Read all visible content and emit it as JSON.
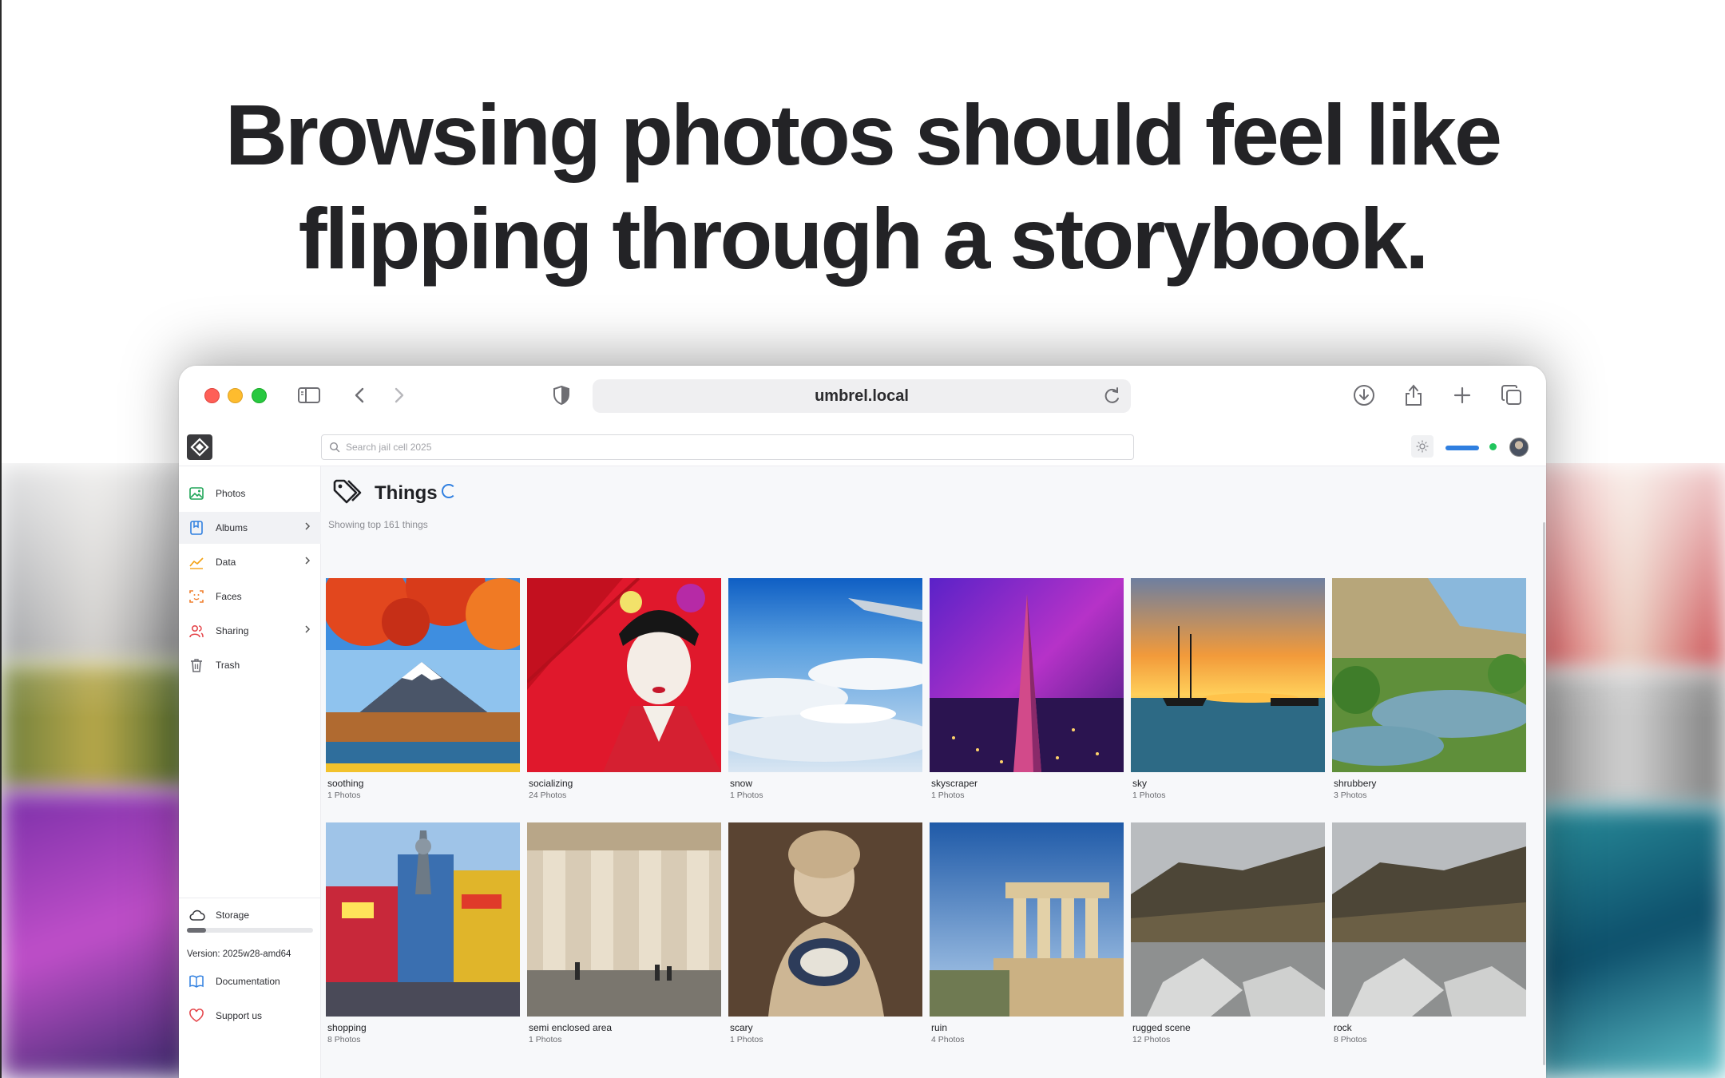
{
  "headline": {
    "line1": "Browsing photos should feel like",
    "line2": "flipping through a storybook."
  },
  "browser": {
    "url": "umbrel.local",
    "icons": [
      "sidebar-toggle-icon",
      "back-icon",
      "forward-icon",
      "shield-icon",
      "reload-icon",
      "download-icon",
      "share-icon",
      "new-tab-icon",
      "tab-overview-icon"
    ]
  },
  "app": {
    "search_placeholder": "Search jail cell 2025",
    "sidebar": {
      "items": [
        {
          "label": "Photos",
          "icon": "image-icon",
          "color": "#22a65a"
        },
        {
          "label": "Albums",
          "icon": "album-icon",
          "color": "#2f7fe0"
        },
        {
          "label": "Data",
          "icon": "chart-icon",
          "color": "#f4a316"
        },
        {
          "label": "Faces",
          "icon": "face-scan-icon",
          "color": "#f08030"
        },
        {
          "label": "Sharing",
          "icon": "users-icon",
          "color": "#e5484d"
        },
        {
          "label": "Trash",
          "icon": "trash-icon",
          "color": "#6b6c72"
        }
      ],
      "storage_label": "Storage",
      "storage_used_fraction": 0.15,
      "version": "Version: 2025w28-amd64",
      "documentation_label": "Documentation",
      "support_label": "Support us"
    },
    "page": {
      "title": "Things",
      "subtitle": "Showing top 161 things"
    },
    "things": [
      {
        "name": "soothing",
        "count": "1 Photos"
      },
      {
        "name": "socializing",
        "count": "24 Photos"
      },
      {
        "name": "snow",
        "count": "1 Photos"
      },
      {
        "name": "skyscraper",
        "count": "1 Photos"
      },
      {
        "name": "sky",
        "count": "1 Photos"
      },
      {
        "name": "shrubbery",
        "count": "3 Photos"
      },
      {
        "name": "shopping",
        "count": "8 Photos"
      },
      {
        "name": "semi enclosed area",
        "count": "1 Photos"
      },
      {
        "name": "scary",
        "count": "1 Photos"
      },
      {
        "name": "ruin",
        "count": "4 Photos"
      },
      {
        "name": "rugged scene",
        "count": "12 Photos"
      },
      {
        "name": "rock",
        "count": "8 Photos"
      }
    ]
  },
  "colors": {
    "accent": "#2f7fe0",
    "status_online": "#21c55d",
    "headline_text": "#232326"
  }
}
